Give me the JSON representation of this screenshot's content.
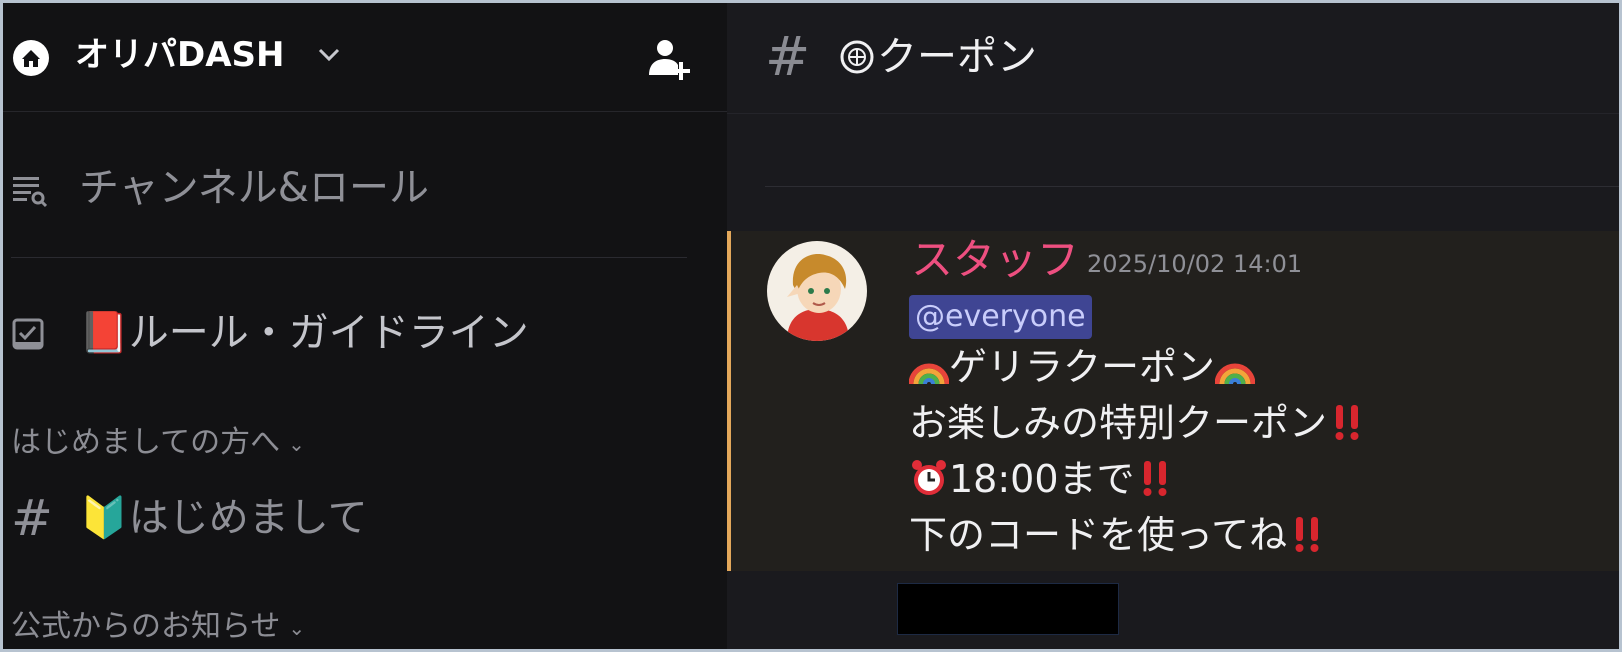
{
  "server": {
    "name": "オリパDASH",
    "icon": "home-icon",
    "invite_icon": "add-member-icon"
  },
  "sidebar": {
    "channels_roles_label": "チャンネル&ロール",
    "rules_label": "📕ルール・ガイドライン",
    "categories": [
      {
        "label": "はじめましての方へ",
        "channels": [
          {
            "label": "🔰はじめまして"
          }
        ]
      },
      {
        "label": "公式からのお知らせ"
      }
    ]
  },
  "channel": {
    "name": "㊙クーポン",
    "display_name": "クーポン"
  },
  "message": {
    "author": "スタッフ",
    "timestamp": "2025/10/02 14:01",
    "mention": "@everyone",
    "lines": [
      "ゲリラクーポン",
      "お楽しみの特別クーポン",
      "18:00まで",
      "下のコードを使ってね"
    ],
    "colors": {
      "author": "#ee4f80",
      "highlight_bar": "#e3a85b",
      "mention_bg": "#3f4593"
    }
  }
}
